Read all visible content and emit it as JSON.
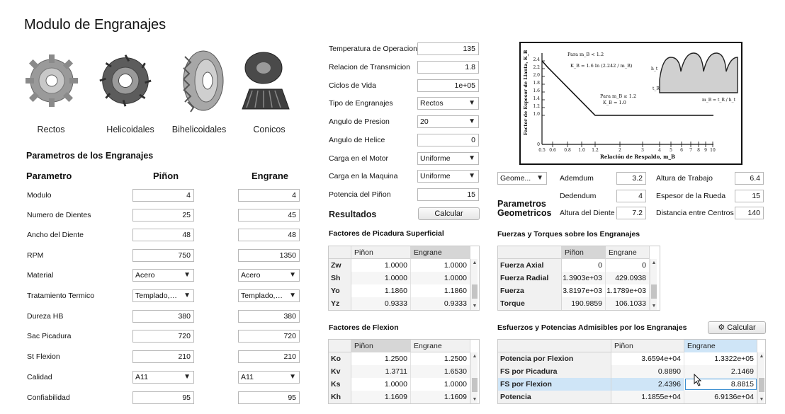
{
  "window": {
    "title": "Modulo de Engranajes"
  },
  "gear_types": [
    {
      "label": "Rectos"
    },
    {
      "label": "Helicoidales"
    },
    {
      "label": "Bihelicoidales"
    },
    {
      "label": "Conicos"
    }
  ],
  "params": {
    "section_title": "Parametros de los Engranajes",
    "col_param": "Parametro",
    "col_pinion": "Piñon",
    "col_gear": "Engrane",
    "rows": [
      {
        "label": "Modulo",
        "pinion": "4",
        "gear": "4"
      },
      {
        "label": "Numero de Dientes",
        "pinion": "25",
        "gear": "45"
      },
      {
        "label": "Ancho del Diente",
        "pinion": "48",
        "gear": "48"
      },
      {
        "label": "RPM",
        "pinion": "750",
        "gear": "1350"
      },
      {
        "label": "Material",
        "pinion": "Acero",
        "gear": "Acero"
      },
      {
        "label": "Tratamiento Termico",
        "pinion": "Templado, r...",
        "gear": "Templado, r..."
      },
      {
        "label": "Dureza HB",
        "pinion": "380",
        "gear": "380"
      },
      {
        "label": "Sac Picadura",
        "pinion": "720",
        "gear": "720"
      },
      {
        "label": "St Flexion",
        "pinion": "210",
        "gear": "210"
      },
      {
        "label": "Calidad",
        "pinion": "A11",
        "gear": "A11"
      },
      {
        "label": "Confiabilidad",
        "pinion": "95",
        "gear": "95"
      }
    ]
  },
  "operation": {
    "rows": [
      {
        "label": "Temperatura de Operacion",
        "value": "135"
      },
      {
        "label": "Relacion de Transmicion",
        "value": "1.8"
      },
      {
        "label": "Ciclos de Vida",
        "value": "1e+05"
      },
      {
        "label": "Tipo de Engranajes",
        "value": "Rectos"
      },
      {
        "label": "Angulo de Presion",
        "value": "20"
      },
      {
        "label": "Angulo de Helice",
        "value": "0"
      },
      {
        "label": "Carga en el Motor",
        "value": "Uniforme"
      },
      {
        "label": "Carga en la Maquina",
        "value": "Uniforme"
      },
      {
        "label": "Potencia del Piñon",
        "value": "15"
      }
    ],
    "results_title": "Resultados",
    "calc_button": "Calcular"
  },
  "diagram": {
    "y_label": "Factor de Espesor de Llanta, K_B",
    "x_label": "Relación de Respaldo, m_B",
    "y_ticks": [
      "0",
      "1.0",
      "1.2",
      "1.4",
      "1.6",
      "1.8",
      "2.0",
      "2.2",
      "2.4"
    ],
    "x_ticks": [
      "0.5",
      "0.6",
      "0.8",
      "1.0",
      "1.2",
      "2",
      "3",
      "4",
      "5",
      "6",
      "7",
      "8",
      "9",
      "10"
    ],
    "ann_1": "Para m_B < 1.2",
    "ann_2": "K_B = 1.6 ln (2.242 / m_B)",
    "ann_3": "Para m_B ≥ 1.2",
    "ann_4": "K_B = 1.0",
    "ann_5": "m_B = t_R / h_t",
    "ann_ht": "h_t",
    "ann_tr": "t_R"
  },
  "geometry": {
    "dropdown": "Geome...",
    "title_line1": "Parametros",
    "title_line2": "Geometricos",
    "fields": [
      {
        "label": "Ademdum",
        "value": "3.2"
      },
      {
        "label": "Dedendum",
        "value": "4"
      },
      {
        "label": "Altura del Diente",
        "value": "7.2"
      },
      {
        "label": "Altura de Trabajo",
        "value": "6.4"
      },
      {
        "label": "Espesor de la Rueda",
        "value": "15"
      },
      {
        "label": "Distancia entre Centros",
        "value": "140"
      }
    ]
  },
  "pitting": {
    "title": "Factores de Picadura Superficial",
    "headers": [
      "Piñon",
      "Engrane"
    ],
    "rows": [
      {
        "name": "Zw",
        "pinion": "1.0000",
        "gear": "1.0000"
      },
      {
        "name": "Sh",
        "pinion": "1.0000",
        "gear": "1.0000"
      },
      {
        "name": "Yo",
        "pinion": "1.1860",
        "gear": "1.1860"
      },
      {
        "name": "Yz",
        "pinion": "0.9333",
        "gear": "0.9333"
      }
    ]
  },
  "bending": {
    "title": "Factores de Flexion",
    "headers": [
      "Piñon",
      "Engrane"
    ],
    "rows": [
      {
        "name": "Ko",
        "pinion": "1.2500",
        "gear": "1.2500"
      },
      {
        "name": "Kv",
        "pinion": "1.3711",
        "gear": "1.6530"
      },
      {
        "name": "Ks",
        "pinion": "1.0000",
        "gear": "1.0000"
      },
      {
        "name": "Kh",
        "pinion": "1.1609",
        "gear": "1.1609"
      }
    ]
  },
  "forces": {
    "title": "Fuerzas y Torques sobre los Engranajes",
    "headers": [
      "Piñon",
      "Engrane"
    ],
    "rows": [
      {
        "name": "Fuerza Axial",
        "pinion": "0",
        "gear": "0"
      },
      {
        "name": "Fuerza Radial",
        "pinion": "1.3903e+03",
        "gear": "429.0938"
      },
      {
        "name": "Fuerza Tangencial",
        "pinion": "3.8197e+03",
        "gear": "1.1789e+03"
      },
      {
        "name": "Torque",
        "pinion": "190.9859",
        "gear": "106.1033"
      }
    ]
  },
  "stresses": {
    "title": "Esfuerzos y Potencias Admisibles por los Engranajes",
    "calc_button": "Calcular",
    "headers": [
      "Piñon",
      "Engrane"
    ],
    "rows": [
      {
        "name": "Potencia por Flexion",
        "pinion": "3.6594e+04",
        "gear": "1.3322e+05"
      },
      {
        "name": "FS por Picadura",
        "pinion": "0.8890",
        "gear": "2.1469"
      },
      {
        "name": "FS por Flexion",
        "pinion": "2.4396",
        "gear": "8.8815"
      },
      {
        "name": "Potencia",
        "pinion": "1.1855e+04",
        "gear": "6.9136e+04"
      }
    ]
  },
  "colors": {
    "selection_blue": "#cfe5f7",
    "header_gray": "#f1f1f1",
    "border": "#b8b8b8"
  }
}
